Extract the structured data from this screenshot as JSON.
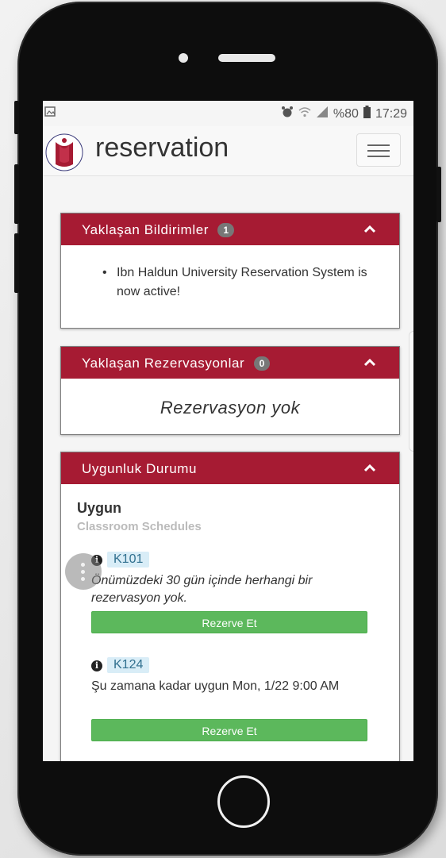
{
  "status_bar": {
    "left_icon": "image-icon",
    "alarm_icon": "alarm-icon",
    "wifi_icon": "wifi-icon",
    "signal_icon": "signal-icon",
    "battery_percent": "%80",
    "battery_icon": "battery-icon",
    "time": "17:29"
  },
  "navbar": {
    "brand": "reservation",
    "menu_icon": "hamburger-icon"
  },
  "panels": {
    "notifications": {
      "title": "Yaklaşan Bildirimler",
      "count": "1",
      "items": [
        "Ibn Haldun University Reservation System is now active!"
      ]
    },
    "reservations": {
      "title": "Yaklaşan Rezervasyonlar",
      "count": "0",
      "empty_text": "Rezervasyon yok"
    },
    "availability": {
      "title": "Uygunluk Durumu",
      "heading": "Uygun",
      "subheading": "Classroom Schedules",
      "rooms": [
        {
          "name": "K101",
          "description": "Önümüzdeki 30 gün içinde herhangi bir rezervasyon yok.",
          "button": "Rezerve Et"
        },
        {
          "name": "K124",
          "description": "Şu zamana kadar uygun Mon, 1/22 9:00 AM",
          "button": "Rezerve Et"
        }
      ]
    }
  },
  "colors": {
    "panel_header": "#a61b33",
    "reserve_button": "#5cb85c",
    "room_label_bg": "#d9edf7"
  }
}
